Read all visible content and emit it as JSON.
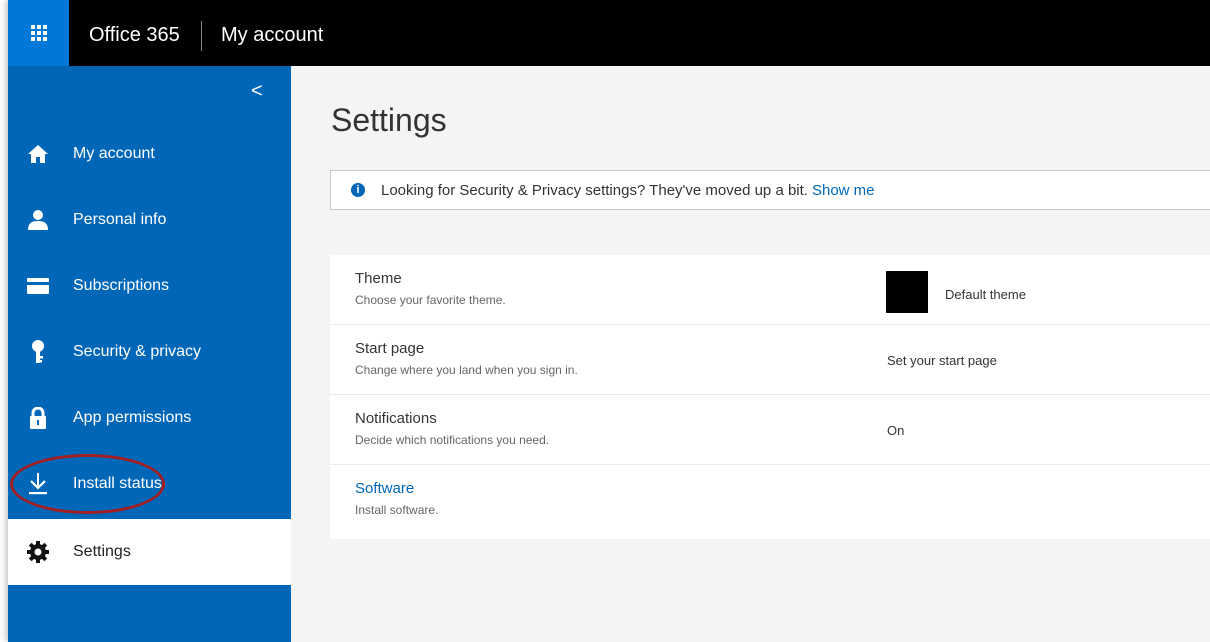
{
  "topbar": {
    "brand": "Office 365",
    "app_title": "My account"
  },
  "sidebar": {
    "collapse_glyph": "<",
    "items": [
      {
        "label": "My account",
        "icon": "home-icon"
      },
      {
        "label": "Personal info",
        "icon": "person-icon"
      },
      {
        "label": "Subscriptions",
        "icon": "card-icon"
      },
      {
        "label": "Security & privacy",
        "icon": "key-icon"
      },
      {
        "label": "App permissions",
        "icon": "lock-icon"
      },
      {
        "label": "Install status",
        "icon": "download-icon"
      },
      {
        "label": "Settings",
        "icon": "gear-icon",
        "active": true
      }
    ],
    "highlight_color": "#a31e22"
  },
  "main": {
    "title": "Settings",
    "banner": {
      "text": "Looking for Security & Privacy settings? They've moved up a bit.",
      "link": "Show me"
    },
    "rows": [
      {
        "title": "Theme",
        "subtitle": "Choose your favorite theme.",
        "value": "Default theme"
      },
      {
        "title": "Start page",
        "subtitle": "Change where you land when you sign in.",
        "value": "Set your start page"
      },
      {
        "title": "Notifications",
        "subtitle": "Decide which notifications you need.",
        "value": "On"
      },
      {
        "title": "Software",
        "subtitle": "Install software.",
        "value": ""
      }
    ]
  },
  "colors": {
    "accent": "#0078d7",
    "sidebar": "#0067b8",
    "topbar": "#000000"
  }
}
